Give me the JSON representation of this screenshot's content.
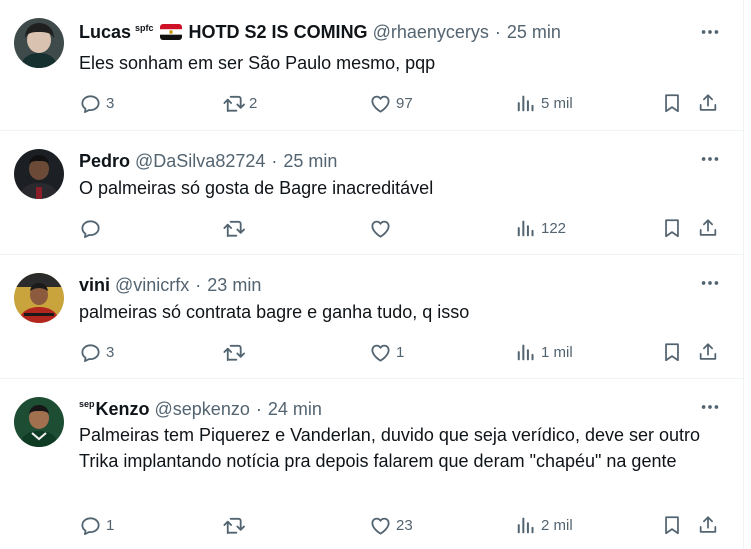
{
  "tweets": [
    {
      "name": "Lucas",
      "name_sup": "spfc",
      "name_suffix": "HOTD S2 IS COMING",
      "handle": "@rhaenycerys",
      "dot": "·",
      "time": "25 min",
      "text": "Eles sonham em ser São Paulo mesmo, pqp",
      "replies": "3",
      "retweets": "2",
      "likes": "97",
      "views": "5 mil"
    },
    {
      "name": "Pedro",
      "handle": "@DaSilva82724",
      "dot": "·",
      "time": "25 min",
      "text": "O palmeiras só gosta de Bagre inacreditável",
      "replies": "",
      "retweets": "",
      "likes": "",
      "views": "122"
    },
    {
      "name": "vini",
      "handle": "@vinicrfx",
      "dot": "·",
      "time": "23 min",
      "text": "palmeiras só contrata bagre e ganha tudo, q isso",
      "replies": "3",
      "retweets": "",
      "likes": "1",
      "views": "1 mil"
    },
    {
      "name_pre": "sep",
      "name": "Kenzo",
      "handle": "@sepkenzo",
      "dot": "·",
      "time": "24 min",
      "text": "Palmeiras tem Piquerez e Vanderlan, duvido que seja verídico, deve ser outro Trika implantando notícia pra depois falarem que deram \"chapéu\" na gente",
      "replies": "1",
      "retweets": "",
      "likes": "23",
      "views": "2 mil"
    }
  ],
  "icons": {
    "more": "more-dots-icon",
    "reply": "reply-bubble-icon",
    "retweet": "retweet-icon",
    "like": "heart-icon",
    "views": "analytics-bars-icon",
    "bookmark": "bookmark-icon",
    "share": "share-upload-icon"
  },
  "colors": {
    "text": "#0f1419",
    "secondary": "#536471",
    "divider": "#eff3f4"
  }
}
